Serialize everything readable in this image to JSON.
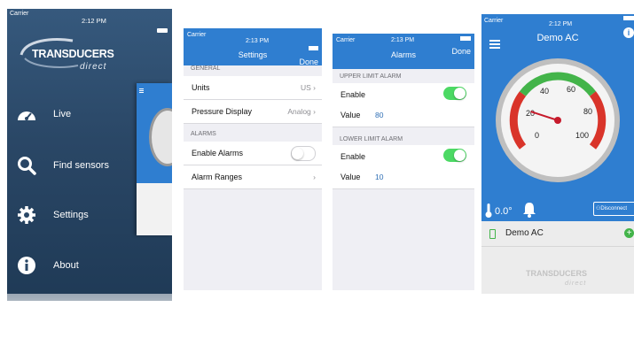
{
  "colors": {
    "nav_blue": "#2f7ed0",
    "menu_bg": "#2a4766",
    "toggle_on": "#4cd964",
    "gauge_green": "#43b44a",
    "gauge_red": "#d9342a"
  },
  "menu_screen": {
    "status_carrier": "Carrier",
    "status_time": "2:12 PM",
    "brand_line1": "TRANSDUCERS",
    "brand_line2": "direct",
    "items": [
      {
        "label": "Live",
        "icon": "dashboard-icon"
      },
      {
        "label": "Find sensors",
        "icon": "search-icon"
      },
      {
        "label": "Settings",
        "icon": "gear-icon"
      },
      {
        "label": "About",
        "icon": "info-icon"
      }
    ]
  },
  "settings_screen": {
    "status_carrier": "Carrier",
    "status_time": "2:13 PM",
    "title": "Settings",
    "done": "Done",
    "section_general": "GENERAL",
    "units_label": "Units",
    "units_value": "US",
    "pressure_label": "Pressure Display",
    "pressure_value": "Analog",
    "section_alarms": "ALARMS",
    "enable_alarms_label": "Enable Alarms",
    "enable_alarms_on": false,
    "alarm_ranges_label": "Alarm Ranges"
  },
  "alarms_screen": {
    "status_carrier": "Carrier",
    "status_time": "2:13 PM",
    "title": "Alarms",
    "done": "Done",
    "upper_section": "UPPER LIMIT ALARM",
    "upper_enable_label": "Enable",
    "upper_enable_on": true,
    "upper_value_label": "Value",
    "upper_value": "80",
    "lower_section": "LOWER LIMIT ALARM",
    "lower_enable_label": "Enable",
    "lower_enable_on": true,
    "lower_value_label": "Value",
    "lower_value": "10"
  },
  "gauge_screen": {
    "status_carrier": "Carrier",
    "status_time": "2:12 PM",
    "title": "Demo AC",
    "gauge_ticks": [
      "0",
      "20",
      "40",
      "60",
      "80",
      "100"
    ],
    "needle_value": 20,
    "temperature": "0.0°",
    "disconnect": "Disconnect",
    "device_name": "Demo AC",
    "brand_line1": "TRANSDUCERS",
    "brand_line2": "direct"
  }
}
